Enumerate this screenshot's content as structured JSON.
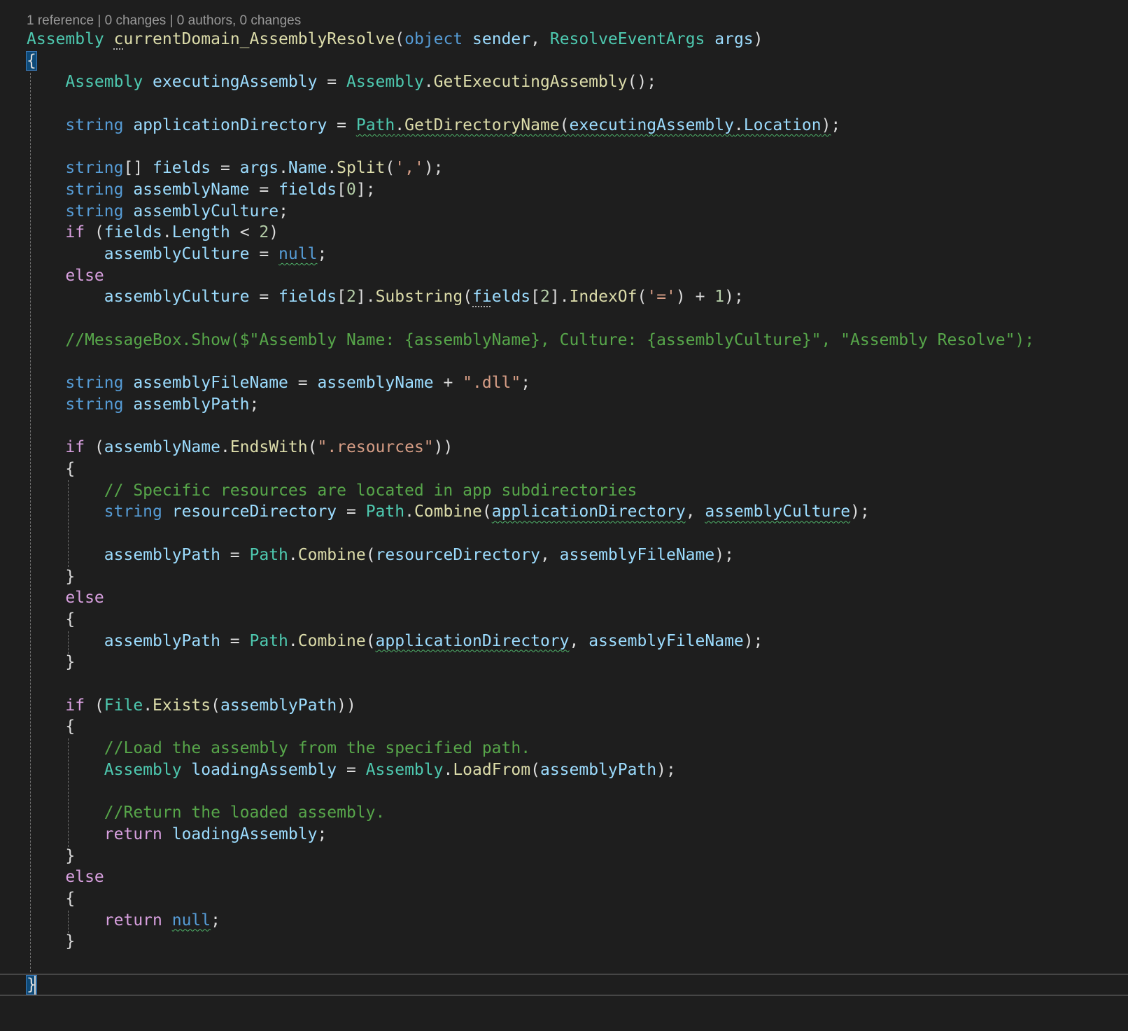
{
  "codelens": {
    "text": "1 reference | 0 changes | 0 authors, 0 changes"
  },
  "lines": [
    {
      "tokens": [
        {
          "t": "Assembly",
          "c": "typ"
        },
        {
          "t": " ",
          "c": "pun"
        },
        {
          "t": "c",
          "c": "meth",
          "u": "dots"
        },
        {
          "t": "urrentDomain_AssemblyResolve",
          "c": "meth"
        },
        {
          "t": "(",
          "c": "pun"
        },
        {
          "t": "object",
          "c": "kw"
        },
        {
          "t": " ",
          "c": "pun"
        },
        {
          "t": "sender",
          "c": "var"
        },
        {
          "t": ", ",
          "c": "pun"
        },
        {
          "t": "ResolveEventArgs",
          "c": "typ"
        },
        {
          "t": " ",
          "c": "pun"
        },
        {
          "t": "args",
          "c": "var"
        },
        {
          "t": ")",
          "c": "pun"
        }
      ]
    },
    {
      "tokens": [
        {
          "t": "{",
          "c": "pun",
          "u": "brace"
        }
      ]
    },
    {
      "tokens": [
        {
          "t": "    ",
          "c": "pun"
        },
        {
          "t": "Assembly",
          "c": "typ"
        },
        {
          "t": " ",
          "c": "pun"
        },
        {
          "t": "executingAssembly",
          "c": "var"
        },
        {
          "t": " = ",
          "c": "pun"
        },
        {
          "t": "Assembly",
          "c": "typ"
        },
        {
          "t": ".",
          "c": "pun"
        },
        {
          "t": "GetExecutingAssembly",
          "c": "meth"
        },
        {
          "t": "();",
          "c": "pun"
        }
      ]
    },
    {
      "tokens": []
    },
    {
      "tokens": [
        {
          "t": "    ",
          "c": "pun"
        },
        {
          "t": "string",
          "c": "kw"
        },
        {
          "t": " ",
          "c": "pun"
        },
        {
          "t": "applicationDirectory",
          "c": "var"
        },
        {
          "t": " = ",
          "c": "pun"
        },
        {
          "t": "Path",
          "c": "typ",
          "u": "squig"
        },
        {
          "t": ".",
          "c": "pun",
          "u": "squig"
        },
        {
          "t": "GetDirectoryName",
          "c": "meth",
          "u": "squig"
        },
        {
          "t": "(",
          "c": "pun",
          "u": "squig"
        },
        {
          "t": "executingAssembly",
          "c": "var",
          "u": "squig"
        },
        {
          "t": ".",
          "c": "pun",
          "u": "squig"
        },
        {
          "t": "Location",
          "c": "var",
          "u": "squig"
        },
        {
          "t": ")",
          "c": "pun",
          "u": "squig"
        },
        {
          "t": ";",
          "c": "pun"
        }
      ]
    },
    {
      "tokens": []
    },
    {
      "tokens": [
        {
          "t": "    ",
          "c": "pun"
        },
        {
          "t": "string",
          "c": "kw"
        },
        {
          "t": "[] ",
          "c": "pun"
        },
        {
          "t": "fields",
          "c": "var"
        },
        {
          "t": " = ",
          "c": "pun"
        },
        {
          "t": "args",
          "c": "var"
        },
        {
          "t": ".",
          "c": "pun"
        },
        {
          "t": "Name",
          "c": "var"
        },
        {
          "t": ".",
          "c": "pun"
        },
        {
          "t": "Split",
          "c": "meth"
        },
        {
          "t": "(",
          "c": "pun"
        },
        {
          "t": "','",
          "c": "str"
        },
        {
          "t": ");",
          "c": "pun"
        }
      ]
    },
    {
      "tokens": [
        {
          "t": "    ",
          "c": "pun"
        },
        {
          "t": "string",
          "c": "kw"
        },
        {
          "t": " ",
          "c": "pun"
        },
        {
          "t": "assemblyName",
          "c": "var"
        },
        {
          "t": " = ",
          "c": "pun"
        },
        {
          "t": "fields",
          "c": "var"
        },
        {
          "t": "[",
          "c": "pun"
        },
        {
          "t": "0",
          "c": "num"
        },
        {
          "t": "];",
          "c": "pun"
        }
      ]
    },
    {
      "tokens": [
        {
          "t": "    ",
          "c": "pun"
        },
        {
          "t": "string",
          "c": "kw"
        },
        {
          "t": " ",
          "c": "pun"
        },
        {
          "t": "assemblyCulture",
          "c": "var"
        },
        {
          "t": ";",
          "c": "pun"
        }
      ]
    },
    {
      "tokens": [
        {
          "t": "    ",
          "c": "pun"
        },
        {
          "t": "if",
          "c": "ctl"
        },
        {
          "t": " (",
          "c": "pun"
        },
        {
          "t": "fields",
          "c": "var"
        },
        {
          "t": ".",
          "c": "pun"
        },
        {
          "t": "Length",
          "c": "var"
        },
        {
          "t": " < ",
          "c": "pun"
        },
        {
          "t": "2",
          "c": "num"
        },
        {
          "t": ")",
          "c": "pun"
        }
      ]
    },
    {
      "tokens": [
        {
          "t": "        ",
          "c": "pun"
        },
        {
          "t": "assemblyCulture",
          "c": "var"
        },
        {
          "t": " = ",
          "c": "pun"
        },
        {
          "t": "null",
          "c": "kw",
          "u": "squig"
        },
        {
          "t": ";",
          "c": "pun"
        }
      ]
    },
    {
      "tokens": [
        {
          "t": "    ",
          "c": "pun"
        },
        {
          "t": "else",
          "c": "ctl"
        }
      ]
    },
    {
      "tokens": [
        {
          "t": "        ",
          "c": "pun"
        },
        {
          "t": "assemblyCulture",
          "c": "var"
        },
        {
          "t": " = ",
          "c": "pun"
        },
        {
          "t": "fields",
          "c": "var"
        },
        {
          "t": "[",
          "c": "pun"
        },
        {
          "t": "2",
          "c": "num"
        },
        {
          "t": "].",
          "c": "pun"
        },
        {
          "t": "Substring",
          "c": "meth"
        },
        {
          "t": "(",
          "c": "pun"
        },
        {
          "t": "fi",
          "c": "var",
          "u": "dots"
        },
        {
          "t": "elds",
          "c": "var"
        },
        {
          "t": "[",
          "c": "pun"
        },
        {
          "t": "2",
          "c": "num"
        },
        {
          "t": "].",
          "c": "pun"
        },
        {
          "t": "IndexOf",
          "c": "meth"
        },
        {
          "t": "(",
          "c": "pun"
        },
        {
          "t": "'='",
          "c": "str"
        },
        {
          "t": ") + ",
          "c": "pun"
        },
        {
          "t": "1",
          "c": "num"
        },
        {
          "t": ");",
          "c": "pun"
        }
      ]
    },
    {
      "tokens": []
    },
    {
      "tokens": [
        {
          "t": "    ",
          "c": "pun"
        },
        {
          "t": "//MessageBox.Show($\"Assembly Name: {assemblyName}, Culture: {assemblyCulture}\", \"Assembly Resolve\");",
          "c": "cmt"
        }
      ]
    },
    {
      "tokens": []
    },
    {
      "tokens": [
        {
          "t": "    ",
          "c": "pun"
        },
        {
          "t": "string",
          "c": "kw"
        },
        {
          "t": " ",
          "c": "pun"
        },
        {
          "t": "assemblyFileName",
          "c": "var"
        },
        {
          "t": " = ",
          "c": "pun"
        },
        {
          "t": "assemblyName",
          "c": "var"
        },
        {
          "t": " + ",
          "c": "pun"
        },
        {
          "t": "\".dll\"",
          "c": "str"
        },
        {
          "t": ";",
          "c": "pun"
        }
      ]
    },
    {
      "tokens": [
        {
          "t": "    ",
          "c": "pun"
        },
        {
          "t": "string",
          "c": "kw"
        },
        {
          "t": " ",
          "c": "pun"
        },
        {
          "t": "assemblyPath",
          "c": "var"
        },
        {
          "t": ";",
          "c": "pun"
        }
      ]
    },
    {
      "tokens": []
    },
    {
      "tokens": [
        {
          "t": "    ",
          "c": "pun"
        },
        {
          "t": "if",
          "c": "ctl"
        },
        {
          "t": " (",
          "c": "pun"
        },
        {
          "t": "assemblyName",
          "c": "var"
        },
        {
          "t": ".",
          "c": "pun"
        },
        {
          "t": "EndsWith",
          "c": "meth"
        },
        {
          "t": "(",
          "c": "pun"
        },
        {
          "t": "\".resources\"",
          "c": "str"
        },
        {
          "t": "))",
          "c": "pun"
        }
      ]
    },
    {
      "tokens": [
        {
          "t": "    {",
          "c": "pun"
        }
      ]
    },
    {
      "tokens": [
        {
          "t": "        ",
          "c": "pun"
        },
        {
          "t": "// Specific resources are located in app subdirectories",
          "c": "cmt"
        }
      ]
    },
    {
      "tokens": [
        {
          "t": "        ",
          "c": "pun"
        },
        {
          "t": "string",
          "c": "kw"
        },
        {
          "t": " ",
          "c": "pun"
        },
        {
          "t": "resourceDirectory",
          "c": "var"
        },
        {
          "t": " = ",
          "c": "pun"
        },
        {
          "t": "Path",
          "c": "typ"
        },
        {
          "t": ".",
          "c": "pun"
        },
        {
          "t": "Combine",
          "c": "meth"
        },
        {
          "t": "(",
          "c": "pun"
        },
        {
          "t": "applicationDirectory",
          "c": "var",
          "u": "squig"
        },
        {
          "t": ", ",
          "c": "pun"
        },
        {
          "t": "assemblyCulture",
          "c": "var",
          "u": "squig"
        },
        {
          "t": ");",
          "c": "pun"
        }
      ]
    },
    {
      "tokens": []
    },
    {
      "tokens": [
        {
          "t": "        ",
          "c": "pun"
        },
        {
          "t": "assemblyPath",
          "c": "var"
        },
        {
          "t": " = ",
          "c": "pun"
        },
        {
          "t": "Path",
          "c": "typ"
        },
        {
          "t": ".",
          "c": "pun"
        },
        {
          "t": "Combine",
          "c": "meth"
        },
        {
          "t": "(",
          "c": "pun"
        },
        {
          "t": "resourceDirectory",
          "c": "var"
        },
        {
          "t": ", ",
          "c": "pun"
        },
        {
          "t": "assemblyFileName",
          "c": "var"
        },
        {
          "t": ");",
          "c": "pun"
        }
      ]
    },
    {
      "tokens": [
        {
          "t": "    }",
          "c": "pun"
        }
      ]
    },
    {
      "tokens": [
        {
          "t": "    ",
          "c": "pun"
        },
        {
          "t": "else",
          "c": "ctl"
        }
      ]
    },
    {
      "tokens": [
        {
          "t": "    {",
          "c": "pun"
        }
      ]
    },
    {
      "tokens": [
        {
          "t": "        ",
          "c": "pun"
        },
        {
          "t": "assemblyPath",
          "c": "var"
        },
        {
          "t": " = ",
          "c": "pun"
        },
        {
          "t": "Path",
          "c": "typ"
        },
        {
          "t": ".",
          "c": "pun"
        },
        {
          "t": "Combine",
          "c": "meth"
        },
        {
          "t": "(",
          "c": "pun"
        },
        {
          "t": "applicationDirectory",
          "c": "var",
          "u": "squig"
        },
        {
          "t": ", ",
          "c": "pun"
        },
        {
          "t": "assemblyFileName",
          "c": "var"
        },
        {
          "t": ");",
          "c": "pun"
        }
      ]
    },
    {
      "tokens": [
        {
          "t": "    }",
          "c": "pun"
        }
      ]
    },
    {
      "tokens": []
    },
    {
      "tokens": [
        {
          "t": "    ",
          "c": "pun"
        },
        {
          "t": "if",
          "c": "ctl"
        },
        {
          "t": " (",
          "c": "pun"
        },
        {
          "t": "File",
          "c": "typ"
        },
        {
          "t": ".",
          "c": "pun"
        },
        {
          "t": "Exists",
          "c": "meth"
        },
        {
          "t": "(",
          "c": "pun"
        },
        {
          "t": "assemblyPath",
          "c": "var"
        },
        {
          "t": "))",
          "c": "pun"
        }
      ]
    },
    {
      "tokens": [
        {
          "t": "    {",
          "c": "pun"
        }
      ]
    },
    {
      "tokens": [
        {
          "t": "        ",
          "c": "pun"
        },
        {
          "t": "//Load the assembly from the specified path.",
          "c": "cmt"
        }
      ]
    },
    {
      "tokens": [
        {
          "t": "        ",
          "c": "pun"
        },
        {
          "t": "Assembly",
          "c": "typ"
        },
        {
          "t": " ",
          "c": "pun"
        },
        {
          "t": "loadingAssembly",
          "c": "var"
        },
        {
          "t": " = ",
          "c": "pun"
        },
        {
          "t": "Assembly",
          "c": "typ"
        },
        {
          "t": ".",
          "c": "pun"
        },
        {
          "t": "LoadFrom",
          "c": "meth"
        },
        {
          "t": "(",
          "c": "pun"
        },
        {
          "t": "assemblyPath",
          "c": "var"
        },
        {
          "t": ");",
          "c": "pun"
        }
      ]
    },
    {
      "tokens": []
    },
    {
      "tokens": [
        {
          "t": "        ",
          "c": "pun"
        },
        {
          "t": "//Return the loaded assembly.",
          "c": "cmt"
        }
      ]
    },
    {
      "tokens": [
        {
          "t": "        ",
          "c": "pun"
        },
        {
          "t": "return",
          "c": "ctl"
        },
        {
          "t": " ",
          "c": "pun"
        },
        {
          "t": "loadingAssembly",
          "c": "var"
        },
        {
          "t": ";",
          "c": "pun"
        }
      ]
    },
    {
      "tokens": [
        {
          "t": "    }",
          "c": "pun"
        }
      ]
    },
    {
      "tokens": [
        {
          "t": "    ",
          "c": "pun"
        },
        {
          "t": "else",
          "c": "ctl"
        }
      ]
    },
    {
      "tokens": [
        {
          "t": "    {",
          "c": "pun"
        }
      ]
    },
    {
      "tokens": [
        {
          "t": "        ",
          "c": "pun"
        },
        {
          "t": "return",
          "c": "ctl"
        },
        {
          "t": " ",
          "c": "pun"
        },
        {
          "t": "null",
          "c": "kw",
          "u": "squig"
        },
        {
          "t": ";",
          "c": "pun"
        }
      ]
    },
    {
      "tokens": [
        {
          "t": "    }",
          "c": "pun"
        }
      ]
    },
    {
      "tokens": []
    },
    {
      "tokens": [
        {
          "t": "}",
          "c": "pun",
          "u": "brace"
        }
      ]
    }
  ]
}
